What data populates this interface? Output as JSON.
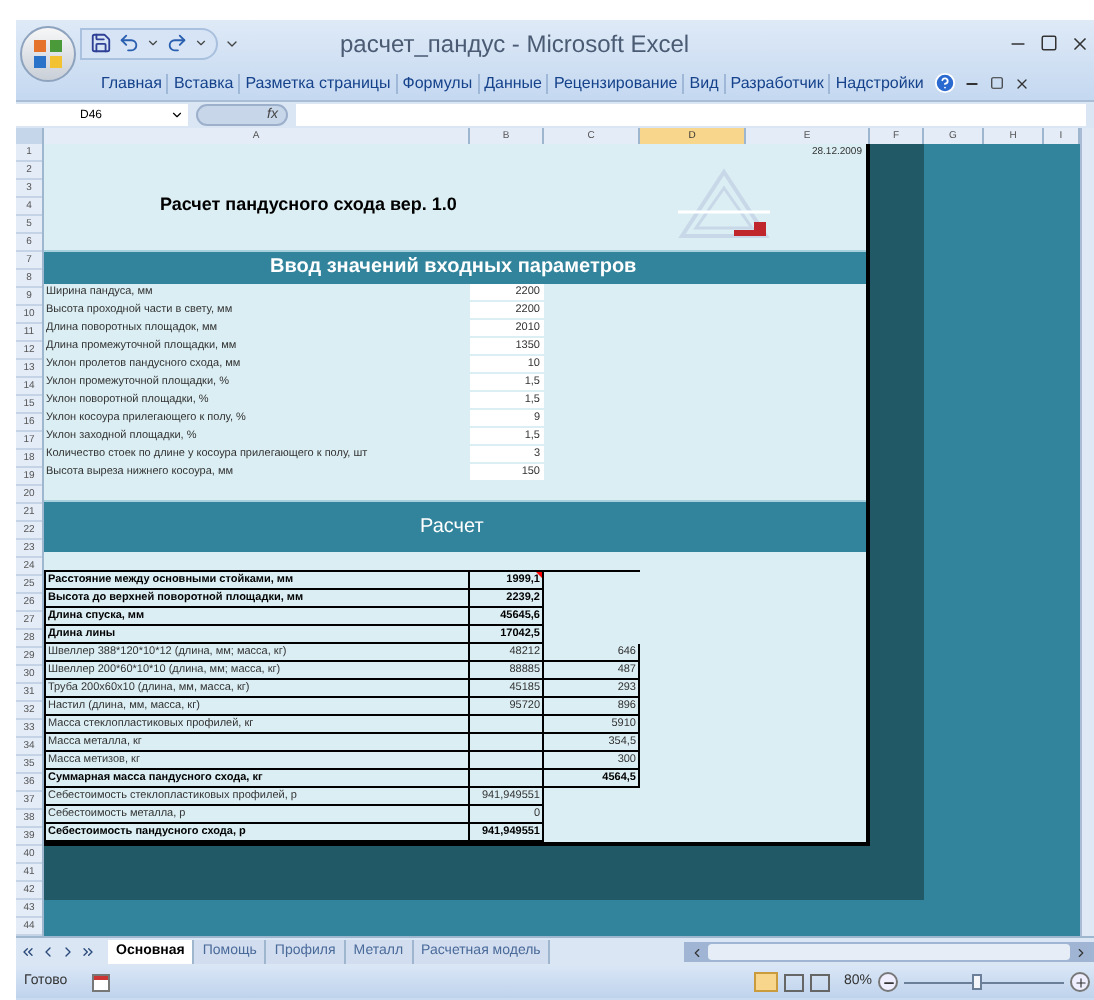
{
  "window": {
    "title": "расчет_пандус - Microsoft Excel"
  },
  "ribbon_tabs": [
    "Главная",
    "Вставка",
    "Разметка страницы",
    "Формулы",
    "Данные",
    "Рецензирование",
    "Вид",
    "Разработчик",
    "Надстройки"
  ],
  "formula_bar": {
    "name_box": "D46",
    "fx": "fx"
  },
  "column_headers": [
    {
      "label": "A",
      "selected": false
    },
    {
      "label": "B",
      "selected": false
    },
    {
      "label": "C",
      "selected": false
    },
    {
      "label": "D",
      "selected": true
    },
    {
      "label": "E",
      "selected": false
    },
    {
      "label": "F",
      "selected": false
    },
    {
      "label": "G",
      "selected": false
    },
    {
      "label": "H",
      "selected": false
    },
    {
      "label": "I",
      "selected": false
    }
  ],
  "row_numbers": [
    "1",
    "2",
    "3",
    "4",
    "5",
    "6",
    "7",
    "8",
    "9",
    "10",
    "11",
    "12",
    "13",
    "14",
    "15",
    "16",
    "17",
    "18",
    "19",
    "20",
    "21",
    "22",
    "23",
    "24",
    "25",
    "26",
    "27",
    "28",
    "29",
    "30",
    "31",
    "32",
    "33",
    "34",
    "35",
    "36",
    "37",
    "38",
    "39",
    "40",
    "41",
    "42",
    "43",
    "44"
  ],
  "sheet": {
    "date": "28.12.2009",
    "title": "Расчет пандусного схода вер. 1.0",
    "input_header": "Ввод значений входных параметров",
    "inputs": [
      {
        "label": "Ширина пандуса, мм",
        "value": "2200"
      },
      {
        "label": "Высота проходной части в свету, мм",
        "value": "2200"
      },
      {
        "label": "Длина поворотных площадок, мм",
        "value": "2010"
      },
      {
        "label": "Длина промежуточной площадки, мм",
        "value": "1350"
      },
      {
        "label": "Уклон пролетов пандусного схода, мм",
        "value": "10"
      },
      {
        "label": "Уклон промежуточной площадки, %",
        "value": "1,5"
      },
      {
        "label": "Уклон поворотной площадки, %",
        "value": "1,5"
      },
      {
        "label": "Уклон косоура прилегающего к полу, %",
        "value": "9"
      },
      {
        "label": "Уклон заходной площадки, %",
        "value": "1,5"
      },
      {
        "label": "Количество стоек по длине у косоура прилегающего к полу, шт",
        "value": "3"
      },
      {
        "label": "Высота выреза нижнего косоура, мм",
        "value": "150"
      }
    ],
    "calc_header": "Расчет",
    "results": [
      {
        "label": "Расстояние между основными стойками, мм",
        "b": "1999,1",
        "bold": true,
        "comment": true
      },
      {
        "label": "Высота до верхней поворотной площадки, мм",
        "b": "2239,2",
        "bold": true,
        "comment": false
      },
      {
        "label": "Длина спуска, мм",
        "b": "45645,6",
        "bold": true,
        "comment": false
      },
      {
        "label": "Длина лины",
        "b": "17042,5",
        "bold": true,
        "comment": false
      },
      {
        "label": "Швеллер 388*120*10*12 (длина, мм; масса, кг)",
        "b": "48212",
        "c": "646",
        "bold": false,
        "comment": false
      },
      {
        "label": "Швеллер 200*60*10*10 (длина, мм; масса, кг)",
        "b": "88885",
        "c": "487",
        "bold": false,
        "comment": false
      },
      {
        "label": "Труба  200х60х10 (длина, мм, масса, кг)",
        "b": "45185",
        "c": "293",
        "bold": false,
        "comment": false
      },
      {
        "label": "Настил (длина, мм, масса, кг)",
        "b": "95720",
        "c": "896",
        "bold": false,
        "comment": false
      },
      {
        "label": "Масса стеклопластиковых профилей, кг",
        "c": "5910",
        "bold": false,
        "comment": false
      },
      {
        "label": "Масса металла, кг",
        "c": "354,5",
        "bold": false,
        "comment": false
      },
      {
        "label": "Масса метизов, кг",
        "c": "300",
        "bold": false,
        "comment": false
      },
      {
        "label": "Суммарная масса пандусного схода, кг",
        "c": "4564,5",
        "bold": true,
        "comment": false
      },
      {
        "label": "Себестоимость стеклопластиковых профилей, р",
        "b": "941,949551",
        "bold": false,
        "comment": false
      },
      {
        "label": "Себестоимость металла, р",
        "b": "0",
        "bold": false,
        "comment": false
      },
      {
        "label": "Себестоимость пандусного схода, р",
        "b": "941,949551",
        "bold": true,
        "comment": false
      }
    ]
  },
  "sheet_tabs": [
    {
      "label": "Основная",
      "selected": true
    },
    {
      "label": "Помощь",
      "selected": false
    },
    {
      "label": "Профиля",
      "selected": false
    },
    {
      "label": "Металл",
      "selected": false
    },
    {
      "label": "Расчетная модель",
      "selected": false
    }
  ],
  "status_bar": {
    "status": "Готово",
    "zoom": "80%",
    "zoom_slider": {
      "level": 0.45
    }
  }
}
